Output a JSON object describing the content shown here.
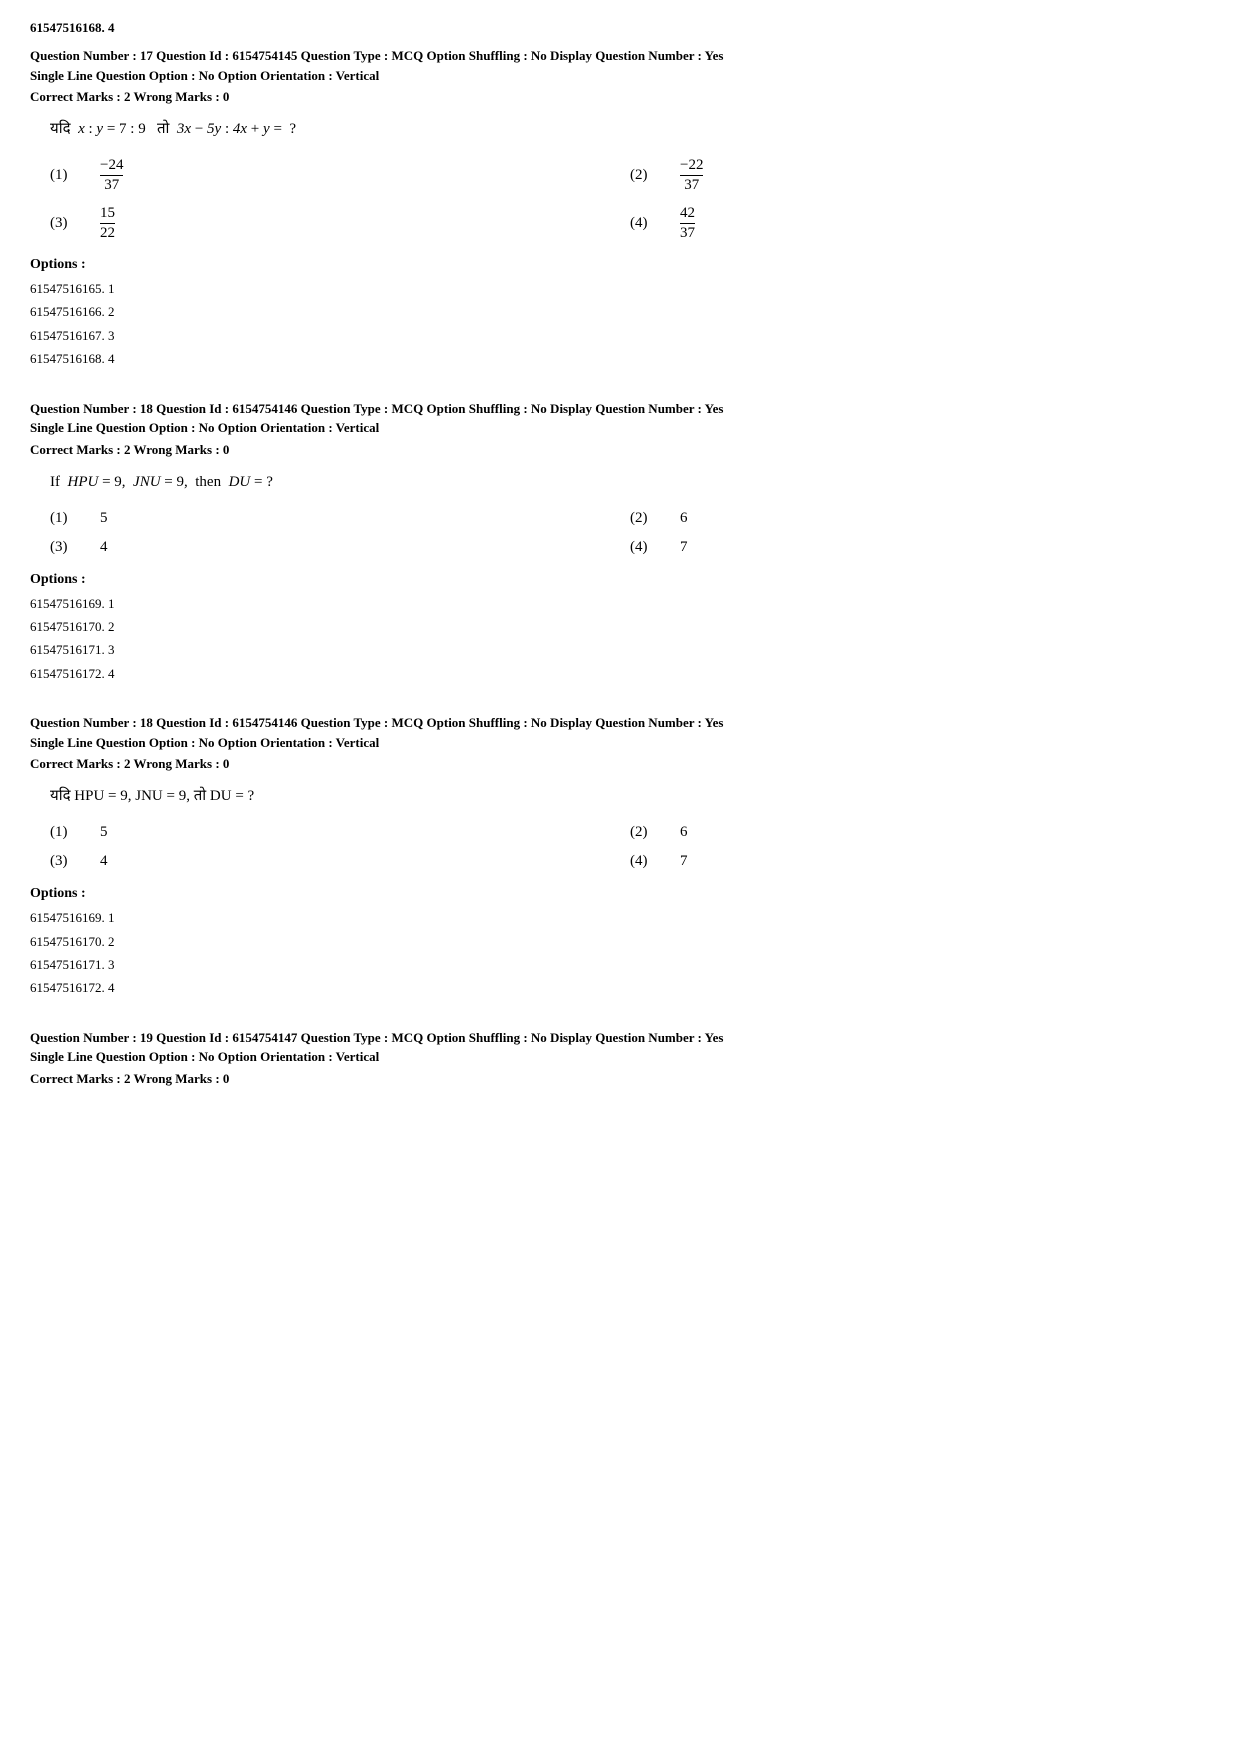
{
  "topId": "61547516168. 4",
  "questions": [
    {
      "id": "q17",
      "meta_line1": "Question Number : 17  Question Id : 6154754145  Question Type : MCQ  Option Shuffling : No  Display Question Number : Yes",
      "meta_line2": "Single Line Question Option : No  Option Orientation : Vertical",
      "marks": "Correct Marks : 2  Wrong Marks : 0",
      "question_type": "fraction_hindi",
      "question_text_hindi": "यदि  x : y = 7 : 9  तो  3x − 5y : 4x + y =  ?",
      "options": [
        {
          "num": "(1)",
          "type": "fraction",
          "numerator": "−24",
          "denominator": "37"
        },
        {
          "num": "(2)",
          "type": "fraction",
          "numerator": "−22",
          "denominator": "37"
        },
        {
          "num": "(3)",
          "type": "fraction",
          "numerator": "15",
          "denominator": "22"
        },
        {
          "num": "(4)",
          "type": "fraction",
          "numerator": "42",
          "denominator": "37"
        }
      ],
      "options_label": "Options :",
      "option_ids": [
        "61547516165. 1",
        "61547516166. 2",
        "61547516167. 3",
        "61547516168. 4"
      ]
    },
    {
      "id": "q18a",
      "meta_line1": "Question Number : 18  Question Id : 6154754146  Question Type : MCQ  Option Shuffling : No  Display Question Number : Yes",
      "meta_line2": "Single Line Question Option : No  Option Orientation : Vertical",
      "marks": "Correct Marks : 2  Wrong Marks : 0",
      "question_type": "text_english",
      "question_text": "If  HPU = 9,  JNU = 9,  then  DU = ?",
      "options": [
        {
          "num": "(1)",
          "type": "text",
          "value": "5"
        },
        {
          "num": "(2)",
          "type": "text",
          "value": "6"
        },
        {
          "num": "(3)",
          "type": "text",
          "value": "4"
        },
        {
          "num": "(4)",
          "type": "text",
          "value": "7"
        }
      ],
      "options_label": "Options :",
      "option_ids": [
        "61547516169. 1",
        "61547516170. 2",
        "61547516171. 3",
        "61547516172. 4"
      ]
    },
    {
      "id": "q18b",
      "meta_line1": "Question Number : 18  Question Id : 6154754146  Question Type : MCQ  Option Shuffling : No  Display Question Number : Yes",
      "meta_line2": "Single Line Question Option : No  Option Orientation : Vertical",
      "marks": "Correct Marks : 2  Wrong Marks : 0",
      "question_type": "text_hindi",
      "question_text_hindi": "यदि HPU = 9, JNU = 9, तो DU = ?",
      "options": [
        {
          "num": "(1)",
          "type": "text",
          "value": "5"
        },
        {
          "num": "(2)",
          "type": "text",
          "value": "6"
        },
        {
          "num": "(3)",
          "type": "text",
          "value": "4"
        },
        {
          "num": "(4)",
          "type": "text",
          "value": "7"
        }
      ],
      "options_label": "Options :",
      "option_ids": [
        "61547516169. 1",
        "61547516170. 2",
        "61547516171. 3",
        "61547516172. 4"
      ]
    },
    {
      "id": "q19",
      "meta_line1": "Question Number : 19  Question Id : 6154754147  Question Type : MCQ  Option Shuffling : No  Display Question Number : Yes",
      "meta_line2": "Single Line Question Option : No  Option Orientation : Vertical",
      "marks": "Correct Marks : 2  Wrong Marks : 0"
    }
  ]
}
